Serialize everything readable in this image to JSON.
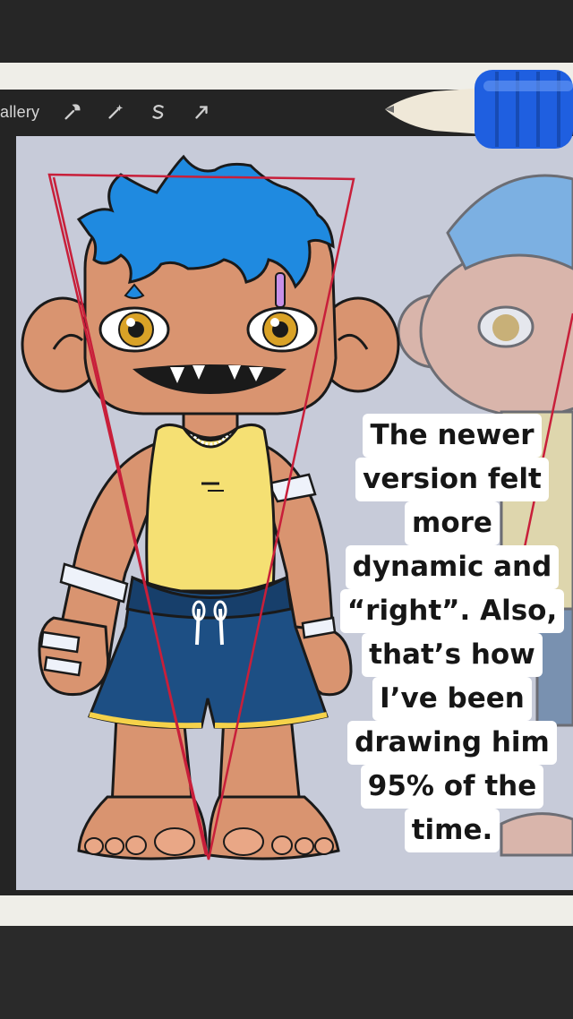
{
  "toolbar": {
    "gallery_label": "allery",
    "tools": [
      {
        "icon": "wrench-icon"
      },
      {
        "icon": "magic-wand-icon"
      },
      {
        "icon": "selection-s-icon"
      },
      {
        "icon": "arrow-cursor-icon"
      }
    ]
  },
  "caption": {
    "lines": [
      "The newer",
      "version felt",
      "more",
      "dynamic and",
      "“right”. Also,",
      "that’s how",
      "I’ve been",
      "drawing him",
      "95% of the",
      "time."
    ]
  },
  "colors": {
    "canvas": "#c7cbd9",
    "hair": "#1f8ae0",
    "skin": "#d99470",
    "shirt": "#f5e073",
    "shorts": "#1d4f84",
    "guide_line": "#c81f3a",
    "pencil_grip": "#1f5fe0"
  }
}
